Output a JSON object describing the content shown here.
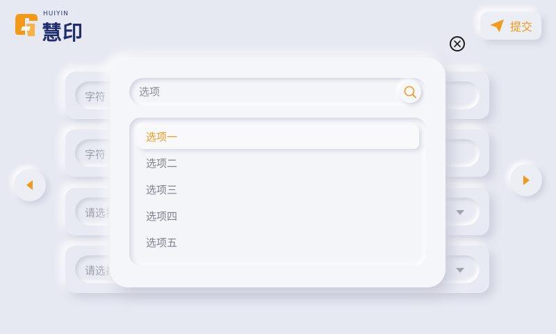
{
  "brand": {
    "logo_sub": "HUIYIN",
    "logo_text": "慧印",
    "accent": "#f29a17"
  },
  "header": {
    "submit_label": "提交",
    "submit_icon": "paper-plane-icon",
    "close_icon": "close-icon"
  },
  "form": {
    "fields": [
      {
        "placeholder": "字符"
      },
      {
        "placeholder": "字符"
      },
      {
        "placeholder": "请选择"
      },
      {
        "placeholder": "请选择"
      }
    ]
  },
  "nav": {
    "prev_icon": "caret-left-icon",
    "next_icon": "caret-right-icon"
  },
  "dropdown": {
    "search_placeholder": "选项",
    "search_icon": "search-icon",
    "options": [
      {
        "label": "选项一",
        "selected": true
      },
      {
        "label": "选项二",
        "selected": false
      },
      {
        "label": "选项三",
        "selected": false
      },
      {
        "label": "选项四",
        "selected": false
      },
      {
        "label": "选项五",
        "selected": false
      }
    ]
  }
}
